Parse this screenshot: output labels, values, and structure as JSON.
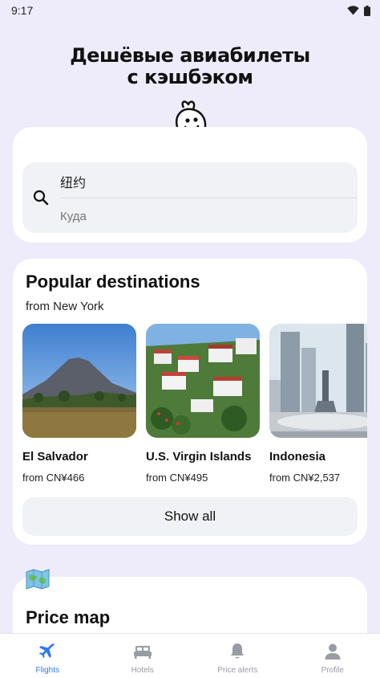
{
  "status_bar": {
    "time": "9:17"
  },
  "hero": {
    "title_line1": "Дешёвые авиабилеты",
    "title_line2": "с кэшбэком"
  },
  "search": {
    "from_value": "纽约",
    "to_placeholder": "Куда"
  },
  "popular": {
    "title": "Popular destinations",
    "subtitle": "from New York",
    "destinations": [
      {
        "name": "El Salvador",
        "price": "from CN¥466"
      },
      {
        "name": "U.S. Virgin Islands",
        "price": "from CN¥495"
      },
      {
        "name": "Indonesia",
        "price": "from CN¥2,537"
      }
    ],
    "show_all_label": "Show all"
  },
  "price_map": {
    "title": "Price map"
  },
  "nav": {
    "items": [
      {
        "label": "Flights",
        "icon": "airplane-icon"
      },
      {
        "label": "Hotels",
        "icon": "bed-icon"
      },
      {
        "label": "Price alerts",
        "icon": "bell-icon"
      },
      {
        "label": "Profile",
        "icon": "person-icon"
      }
    ],
    "active_color": "#2F7BEF",
    "inactive_color": "#9A9CA3"
  }
}
